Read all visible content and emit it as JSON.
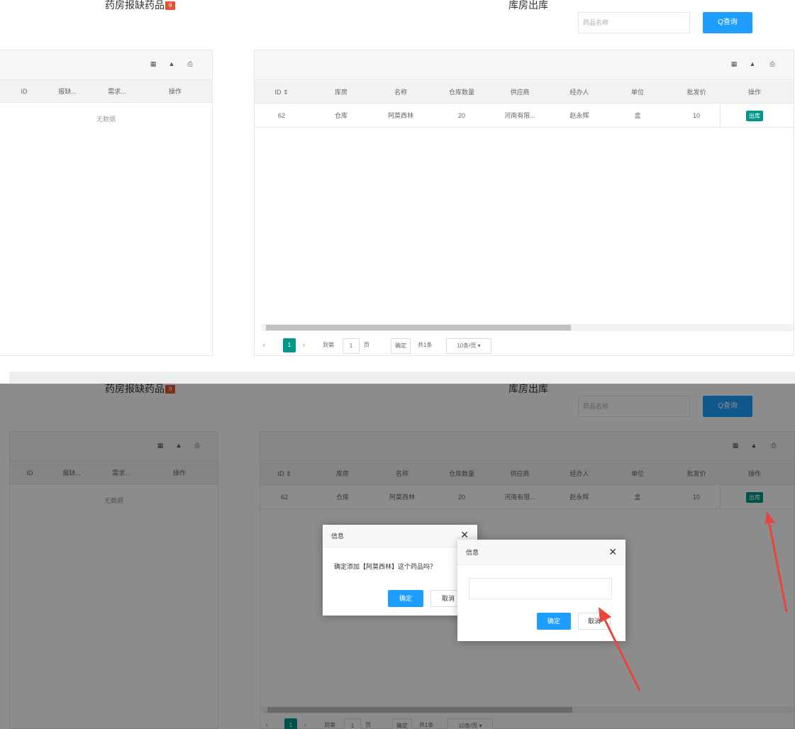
{
  "header": {
    "left_title": "药房报缺药品",
    "left_badge": "9",
    "right_title": "库房出库",
    "search_placeholder": "药品名称",
    "search_button": "Q查询"
  },
  "toolbar_icons": [
    "columns-icon",
    "export-icon",
    "print-icon"
  ],
  "toolbar_glyphs": [
    "▦",
    "▲",
    "⎙"
  ],
  "left_table": {
    "columns": [
      "ID",
      "报缺...",
      "需求...",
      "操作"
    ],
    "empty_text": "无数据"
  },
  "right_table": {
    "columns": [
      "ID ⇕",
      "库房",
      "名称",
      "仓库数量",
      "供应商",
      "经办人",
      "单位",
      "批发价",
      "操作"
    ],
    "rows": [
      {
        "id": "62",
        "warehouse": "仓库",
        "name": "阿莫西林",
        "qty": "20",
        "supplier": "河南有限...",
        "handler": "赵永辉",
        "unit": "盒",
        "price": "10",
        "action": "出库"
      }
    ]
  },
  "pager": {
    "prev": "‹",
    "current": "1",
    "next": "›",
    "goto": "到第",
    "page_input": "1",
    "page_unit": "页",
    "confirm": "确定",
    "total": "共1条",
    "page_size": "10条/页 ▾"
  },
  "dialog_confirm": {
    "title": "信息",
    "close": "✕",
    "message": "确定添加【阿莫西林】这个药品吗？",
    "ok": "确定",
    "cancel": "取消"
  },
  "dialog_prompt": {
    "title": "信息",
    "close": "✕",
    "input_value": "",
    "ok": "确定",
    "cancel": "取消"
  },
  "colors": {
    "accent_blue": "#1e9fff",
    "accent_green": "#009688",
    "badge_red": "#e4532d",
    "arrow_red": "#e8453c"
  }
}
